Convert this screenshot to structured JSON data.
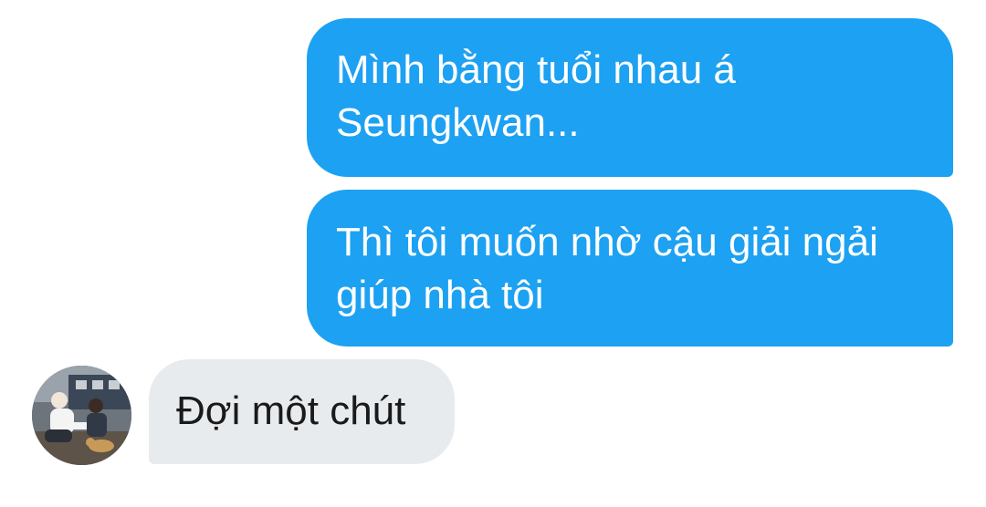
{
  "messages": [
    {
      "direction": "sent",
      "text": "Mình bằng tuổi nhau á\nSeungkwan..."
    },
    {
      "direction": "sent",
      "text": "Thì tôi muốn nhờ cậu giải ngải\ngiúp nhà tôi"
    },
    {
      "direction": "received",
      "text": "Đợi một chút"
    }
  ],
  "colors": {
    "sent_bubble": "#1da1f2",
    "received_bubble": "#e7ebee",
    "background": "#ffffff"
  },
  "icons": {
    "sender_avatar": "avatar-photo"
  }
}
